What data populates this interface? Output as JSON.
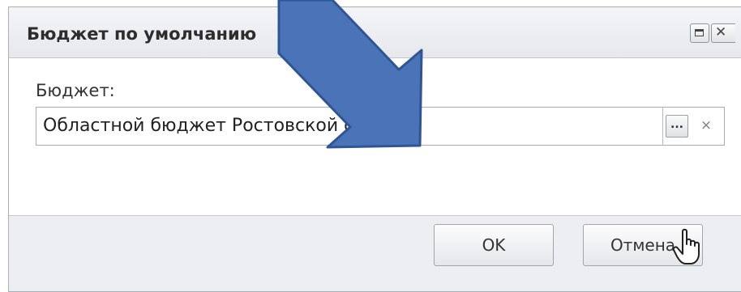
{
  "dialog": {
    "title": "Бюджет по умолчанию",
    "icons": {
      "maximize": "window-maximize-icon",
      "close": "close-icon"
    }
  },
  "form": {
    "budget_label": "Бюджет:",
    "budget_value": "Областной бюджет Ростовской области",
    "select_button": "...",
    "clear_button": "×"
  },
  "buttons": {
    "ok": "OK",
    "cancel": "Отмена"
  },
  "overlay": {
    "annotation": "blue-pointer-arrow-icon",
    "cursor": "hand-pointer-icon",
    "arrow_color": "#4a73b8"
  }
}
